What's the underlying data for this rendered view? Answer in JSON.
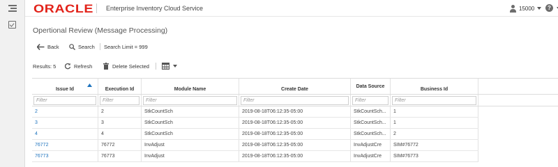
{
  "app": {
    "logo_text": "ORACLE",
    "title": "Enterprise Inventory Cloud Service",
    "user_id": "15000"
  },
  "page": {
    "title": "Opertional Review (Message Processing)"
  },
  "toolbar": {
    "back_label": "Back",
    "search_label": "Search",
    "search_limit": "Search Limit = 999"
  },
  "results": {
    "label": "Results: 5",
    "refresh_label": "Refresh",
    "delete_label": "Delete Selected"
  },
  "table": {
    "columns": [
      {
        "key": "issue_id",
        "label": "Issue Id",
        "sorted": "asc"
      },
      {
        "key": "execution_id",
        "label": "Execution Id"
      },
      {
        "key": "module_name",
        "label": "Module Name"
      },
      {
        "key": "create_date",
        "label": "Create Date"
      },
      {
        "key": "data_source",
        "label": "Data Source"
      },
      {
        "key": "business_id",
        "label": "Business Id"
      }
    ],
    "filter_placeholder": "Filter",
    "rows": [
      {
        "issue_id": "2",
        "execution_id": "2",
        "module_name": "StkCountSch",
        "create_date": "2019-08-18T06:12:35-05:00",
        "data_source": "StkCountSch...",
        "business_id": "1"
      },
      {
        "issue_id": "3",
        "execution_id": "3",
        "module_name": "StkCountSch",
        "create_date": "2019-08-18T06:12:35-05:00",
        "data_source": "StkCountSch...",
        "business_id": "1"
      },
      {
        "issue_id": "4",
        "execution_id": "4",
        "module_name": "StkCountSch",
        "create_date": "2019-08-18T06:12:35-05:00",
        "data_source": "StkCountSch...",
        "business_id": "2"
      },
      {
        "issue_id": "76772",
        "execution_id": "76772",
        "module_name": "InvAdjust",
        "create_date": "2019-08-18T06:12:35-05:00",
        "data_source": "InvAdjustCre",
        "business_id": "SIM#76772"
      },
      {
        "issue_id": "76773",
        "execution_id": "76773",
        "module_name": "InvAdjust",
        "create_date": "2019-08-18T06:12:35-05:00",
        "data_source": "InvAdjustCre",
        "business_id": "SIM#76773"
      }
    ]
  },
  "colors": {
    "brand": "#e2231a",
    "link": "#1e73be"
  }
}
